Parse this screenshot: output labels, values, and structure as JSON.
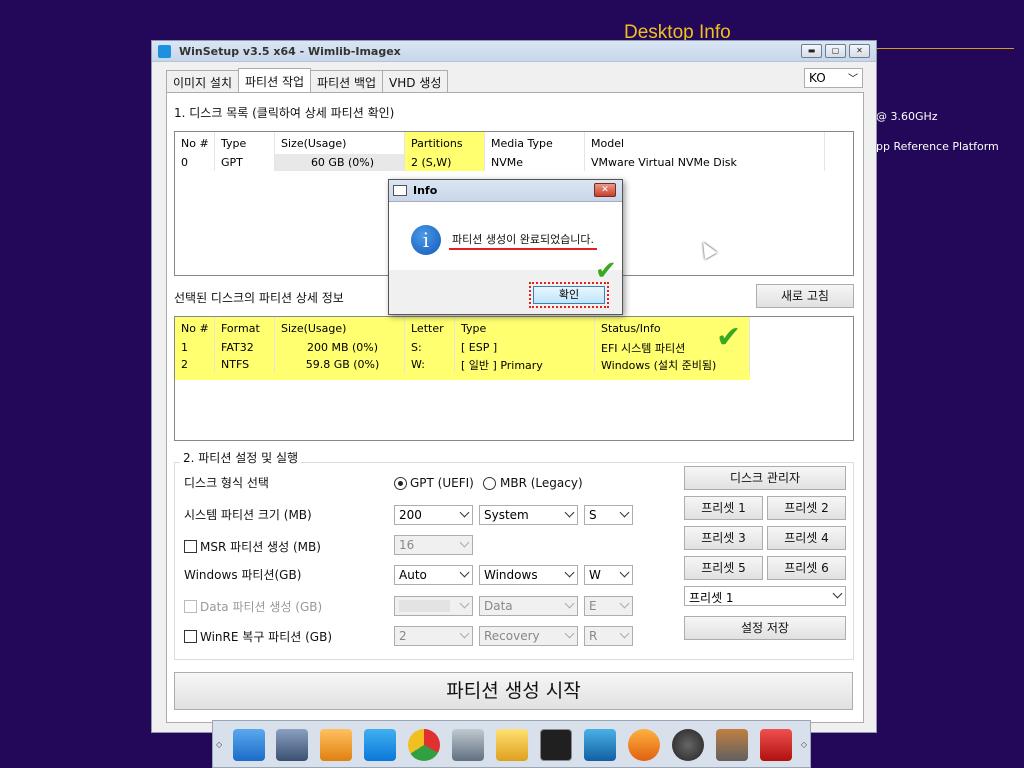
{
  "desktop": {
    "title": "Desktop Info",
    "cpu_frag": "@ 3.60GHz",
    "platform_frag": "pp Reference Platform"
  },
  "window": {
    "title": "WinSetup v3.5 x64 - Wimlib-Imagex",
    "lang": "KO",
    "tabs": [
      "이미지 설치",
      "파티션 작업",
      "파티션 백업",
      "VHD 생성"
    ]
  },
  "disk_list": {
    "section_title": "1. 디스크 목록 (클릭하여 상세 파티션 확인)",
    "headers": [
      "No #",
      "Type",
      "Size(Usage)",
      "Partitions",
      "Media Type",
      "Model"
    ],
    "rows": [
      [
        "0",
        "GPT",
        "60 GB (0%)",
        "2 (S,W)",
        "NVMe",
        "VMware Virtual NVMe Disk"
      ]
    ]
  },
  "partition_detail": {
    "section_title": "선택된 디스크의 파티션 상세 정보",
    "refresh_label": "새로 고침",
    "headers": [
      "No #",
      "Format",
      "Size(Usage)",
      "Letter",
      "Type",
      "Status/Info"
    ],
    "rows": [
      [
        "1",
        "FAT32",
        "200 MB (0%)",
        "S:",
        "[ ESP ]",
        "EFI 시스템 파티션"
      ],
      [
        "2",
        "NTFS",
        "59.8 GB (0%)",
        "W:",
        "[ 일반 ] Primary",
        "Windows (설치 준비됨)"
      ]
    ]
  },
  "settings": {
    "group_title": "2. 파티션 설정 및 실행",
    "disk_format_label": "디스크 형식 선택",
    "gpt_label": "GPT (UEFI)",
    "mbr_label": "MBR (Legacy)",
    "sys_part_label": "시스템 파티션 크기 (MB)",
    "sys_size": "200",
    "sys_name": "System",
    "sys_letter": "S",
    "msr_label": "MSR 파티션 생성 (MB)",
    "msr_size": "16",
    "win_label": "Windows 파티션(GB)",
    "win_size": "Auto",
    "win_name": "Windows",
    "win_letter": "W",
    "data_label": "Data 파티션 생성 (GB)",
    "data_name": "Data",
    "data_letter": "E",
    "winre_label": "WinRE 복구 파티션 (GB)",
    "winre_size": "2",
    "winre_name": "Recovery",
    "winre_letter": "R",
    "disk_mgmt_label": "디스크 관리자",
    "presets": [
      "프리셋 1",
      "프리셋 2",
      "프리셋 3",
      "프리셋 4",
      "프리셋 5",
      "프리셋 6"
    ],
    "preset_select": "프리셋 1",
    "save_label": "설정 저장",
    "start_label": "파티션 생성 시작"
  },
  "dialog": {
    "title": "Info",
    "message": "파티션 생성이 완료되었습니다.",
    "ok_label": "확인"
  },
  "taskbar_icons": [
    "winsetup-icon",
    "setup-tool-icon",
    "usb-icon",
    "windows-icon",
    "chrome-icon",
    "tools-icon",
    "explorer-icon",
    "cmd-icon",
    "display-icon",
    "sync-icon",
    "settings-icon",
    "hammer-icon",
    "power-icon"
  ],
  "colors": {
    "desktop": "#230758",
    "highlight": "#ffff70",
    "check": "#3aa820",
    "alert": "#e02020"
  }
}
